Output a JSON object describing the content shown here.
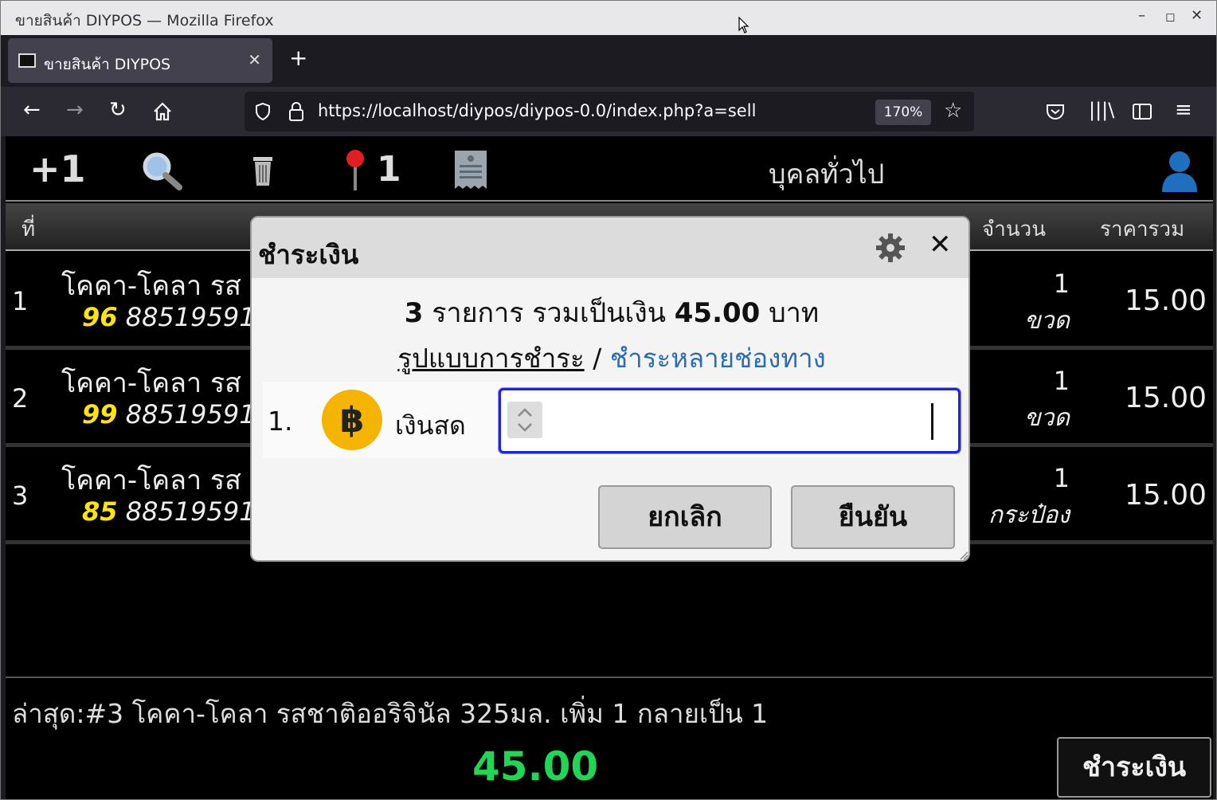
{
  "browser": {
    "window_title": "ขายสินค้า DIYPOS — Mozilla Firefox",
    "tab_title": "ขายสินค้า DIYPOS",
    "url": "https://localhost/diypos/diypos-0.0/index.php?a=sell",
    "zoom": "170%"
  },
  "toolbar": {
    "plus_label": "+1",
    "pin_count": "1",
    "customer": "บุคลทั่วไป"
  },
  "table": {
    "headers": {
      "no": "ที่",
      "qty": "จำนวน",
      "total": "ราคารวม"
    },
    "rows": [
      {
        "no": "1",
        "name": "โคคา-โคลา รส",
        "stock": "96",
        "barcode": "88519591",
        "qty": "1",
        "unit": "ขวด",
        "price": "15.00"
      },
      {
        "no": "2",
        "name": "โคคา-โคลา รส",
        "stock": "99",
        "barcode": "88519591",
        "qty": "1",
        "unit": "ขวด",
        "price": "15.00"
      },
      {
        "no": "3",
        "name": "โคคา-โคลา รส",
        "stock": "85",
        "barcode": "88519591",
        "qty": "1",
        "unit": "กระป๋อง",
        "price": "15.00"
      }
    ]
  },
  "footer": {
    "last_action": "ล่าสุด:#3 โคคา-โคลา รสชาติออริจินัล 325มล. เพิ่ม 1 กลายเป็น 1",
    "total": "45.00",
    "pay_button": "ชำระเงิน"
  },
  "dialog": {
    "title": "ชำระเงิน",
    "item_count": "3",
    "summary_mid": "รายการ รวมเป็นเงิน",
    "amount": "45.00",
    "currency": "บาท",
    "method_link": "รูปแบบการชำระ",
    "separator": "/",
    "multi_link": "ชำระหลายช่องทาง",
    "payment_index": "1.",
    "payment_method": "เงินสด",
    "cancel": "ยกเลิก",
    "confirm": "ยืนยัน"
  },
  "icons": [
    "pointer-icon",
    "back-icon",
    "forward-icon",
    "reload-icon",
    "home-icon",
    "shield-icon",
    "lock-icon",
    "star-icon",
    "pocket-icon",
    "library-icon",
    "sidebar-icon",
    "menu-icon",
    "search-icon",
    "trash-icon",
    "pin-icon",
    "receipt-icon",
    "user-icon",
    "gear-icon",
    "close-icon",
    "baht-icon"
  ]
}
